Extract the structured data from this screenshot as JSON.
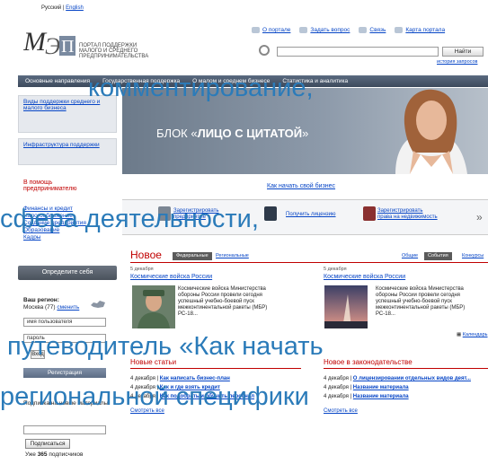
{
  "lang": {
    "current": "Русский",
    "separator": " | ",
    "other": "English"
  },
  "logo": {
    "line1": "ПОРТАЛ ПОДДЕРЖКИ",
    "line2": "МАЛОГО И СРЕДНЕГО",
    "line3": "ПРЕДПРИНИМАТЕЛЬСТВА"
  },
  "toplinks": [
    {
      "label": "О портале",
      "icon": "page-icon"
    },
    {
      "label": "Задать вопрос",
      "icon": "question-icon"
    },
    {
      "label": "Связь",
      "icon": "mail-icon"
    },
    {
      "label": "Карта портала",
      "icon": "sitemap-icon"
    }
  ],
  "search": {
    "button": "Найти",
    "advanced": "история запросов"
  },
  "nav": [
    "Основные направления",
    "Государственная поддержка",
    "О малом и среднем бизнесе",
    "Статистика и аналитика"
  ],
  "sidebar": {
    "box1": "Виды поддержки среднего и малого бизнеса",
    "box2": "Инфраструктура поддержки",
    "help_title": "В помощь предпринимателю",
    "links": [
      "Финансы и кредит",
      "Налогообложение",
      "Создание предприятия",
      "Образование",
      "Кадры"
    ],
    "define": "Определите себя",
    "region_title": "Ваш регион:",
    "region_value": "Москва (77)",
    "region_change": "сменить",
    "username_value": "имя пользователя",
    "password_value": "пароль",
    "login": "Вход",
    "register": "Регистрация",
    "subscribe_title": "Подписка на новые материалы",
    "subscribe_btn": "Подписаться",
    "subscribers_prefix": "Уже ",
    "subscribers_count": "365",
    "subscribers_suffix": " подписчиков"
  },
  "banner": {
    "prefix": "БЛОК «",
    "bold": "ЛИЦО С ЦИТАТОЙ",
    "suffix": "»"
  },
  "start_link": "Как начать свой бизнес",
  "carousel": [
    {
      "line1": "Зарегистрировать",
      "line2": "предприятие"
    },
    {
      "line1": "Получить лицензию",
      "line2": ""
    },
    {
      "line1": "Зарегистрировать",
      "line2": "права на недвижимость"
    }
  ],
  "news": {
    "title": "Новое",
    "tags_left": [
      "Федеральные",
      "Региональные"
    ],
    "tags_right": [
      "Общие",
      "События",
      "Конкурсы"
    ],
    "items": [
      {
        "date": "5 декабря",
        "title": "Космические войска России",
        "text": "Космические войска Министерства обороны России провели сегодня успешный учебно-боевой пуск межконтинентальной ракеты (МБР) РС-18..."
      },
      {
        "date": "5 декабря",
        "title": "Космические войска России",
        "text": "Космические войска Министерства обороны России провели сегодня успешный учебно-боевой пуск межконтинентальной ракеты (МБР) РС-18..."
      }
    ],
    "calendar": "Календарь"
  },
  "articles": {
    "title": "Новые статьи",
    "items": [
      {
        "date": "4 декабря | ",
        "title": "Как написать бизнес-план"
      },
      {
        "date": "4 декабря | ",
        "title": "Как и где взять кредит"
      },
      {
        "date": "4 декабря | ",
        "title": "Как подобрать и обучить персонал"
      }
    ],
    "more": "Смотреть все"
  },
  "laws": {
    "title": "Новое в законодательстве",
    "items": [
      {
        "date": "4 декабря | ",
        "title": "О лицензировании отдельных видов деят..."
      },
      {
        "date": "4 декабря | ",
        "title": "Название материала"
      },
      {
        "date": "4 декабря | ",
        "title": "Название материала"
      }
    ],
    "more": "Смотреть все"
  },
  "overlay": {
    "line1": "комментирование,",
    "line2": "сфера деятельности,",
    "line3": "путеводитель «Как начать",
    "line4": "региональной специфики"
  }
}
